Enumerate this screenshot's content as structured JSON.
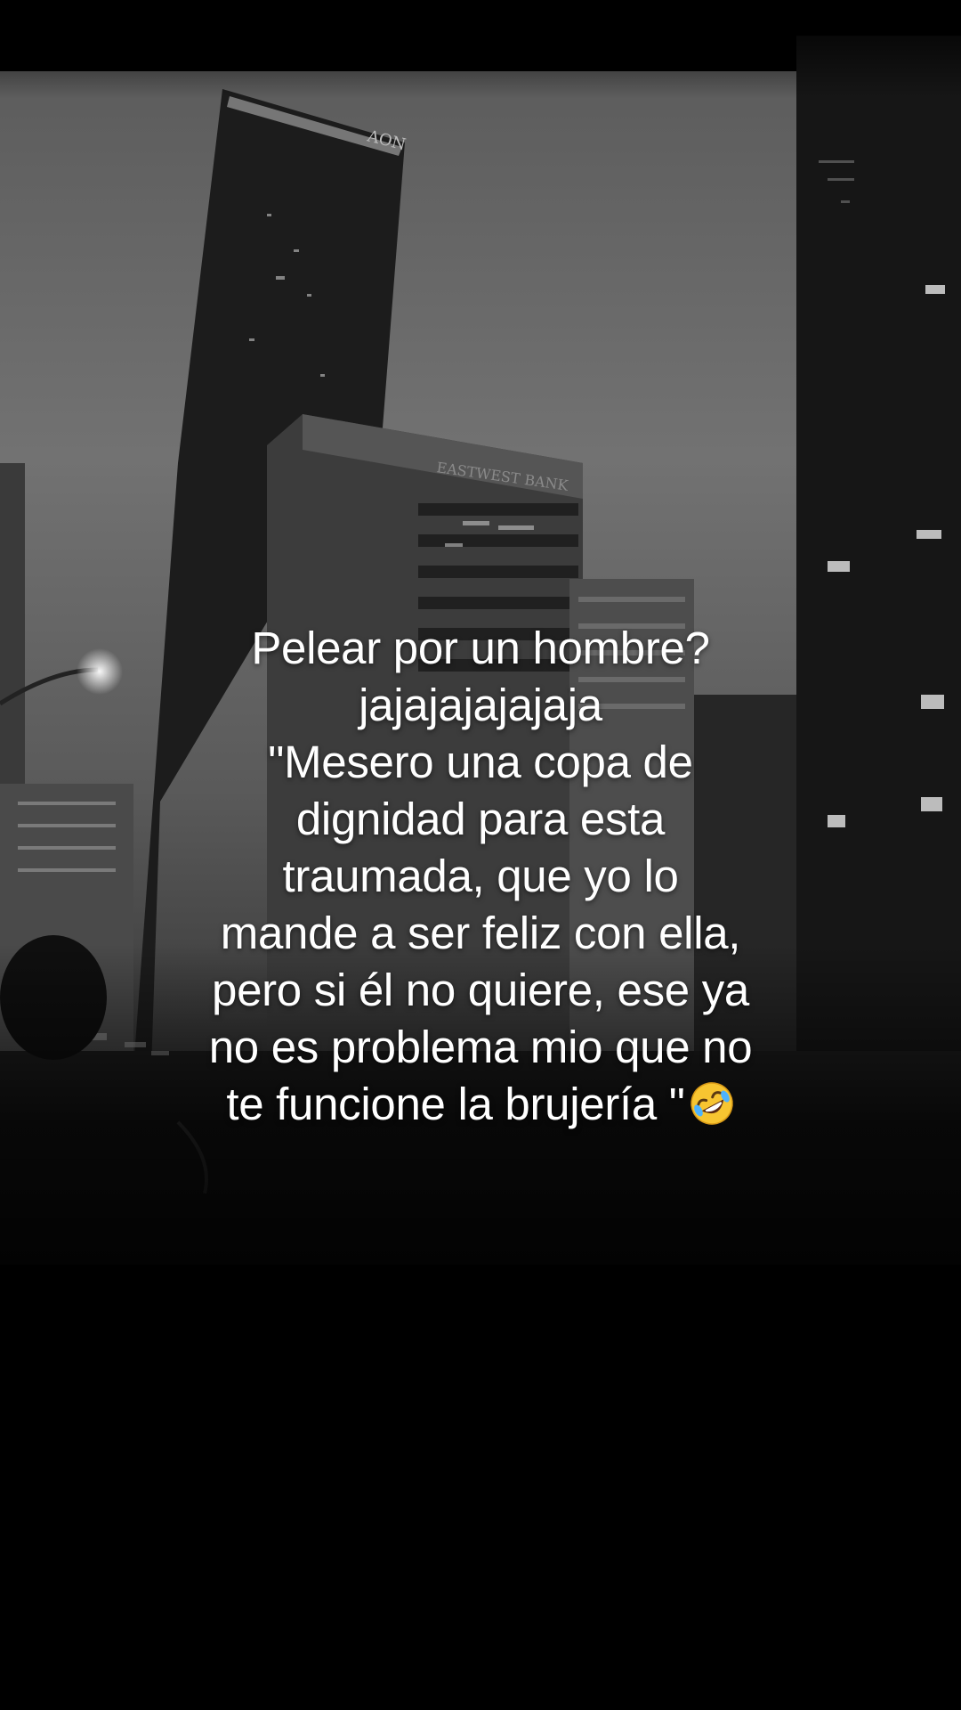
{
  "caption": {
    "lines": [
      "Pelear por un hombre?",
      "jajajajajajaja",
      "\"Mesero una copa de",
      "dignidad para esta",
      "traumada, que yo lo",
      "mande a ser feliz con ella,",
      "pero si él no quiere, ese ya",
      "no es problema mio que no",
      "te funcione la brujería \""
    ],
    "emoji": "rolling-on-floor-laughing-emoji"
  },
  "photo_signage": {
    "tower_top": "AON",
    "bank_sign": "EASTWEST BANK"
  },
  "colors": {
    "sky": "#6f6f6f",
    "building_dark": "#1a1a1a",
    "overlay_bottom": "#000000",
    "caption_text": "#ffffff"
  }
}
